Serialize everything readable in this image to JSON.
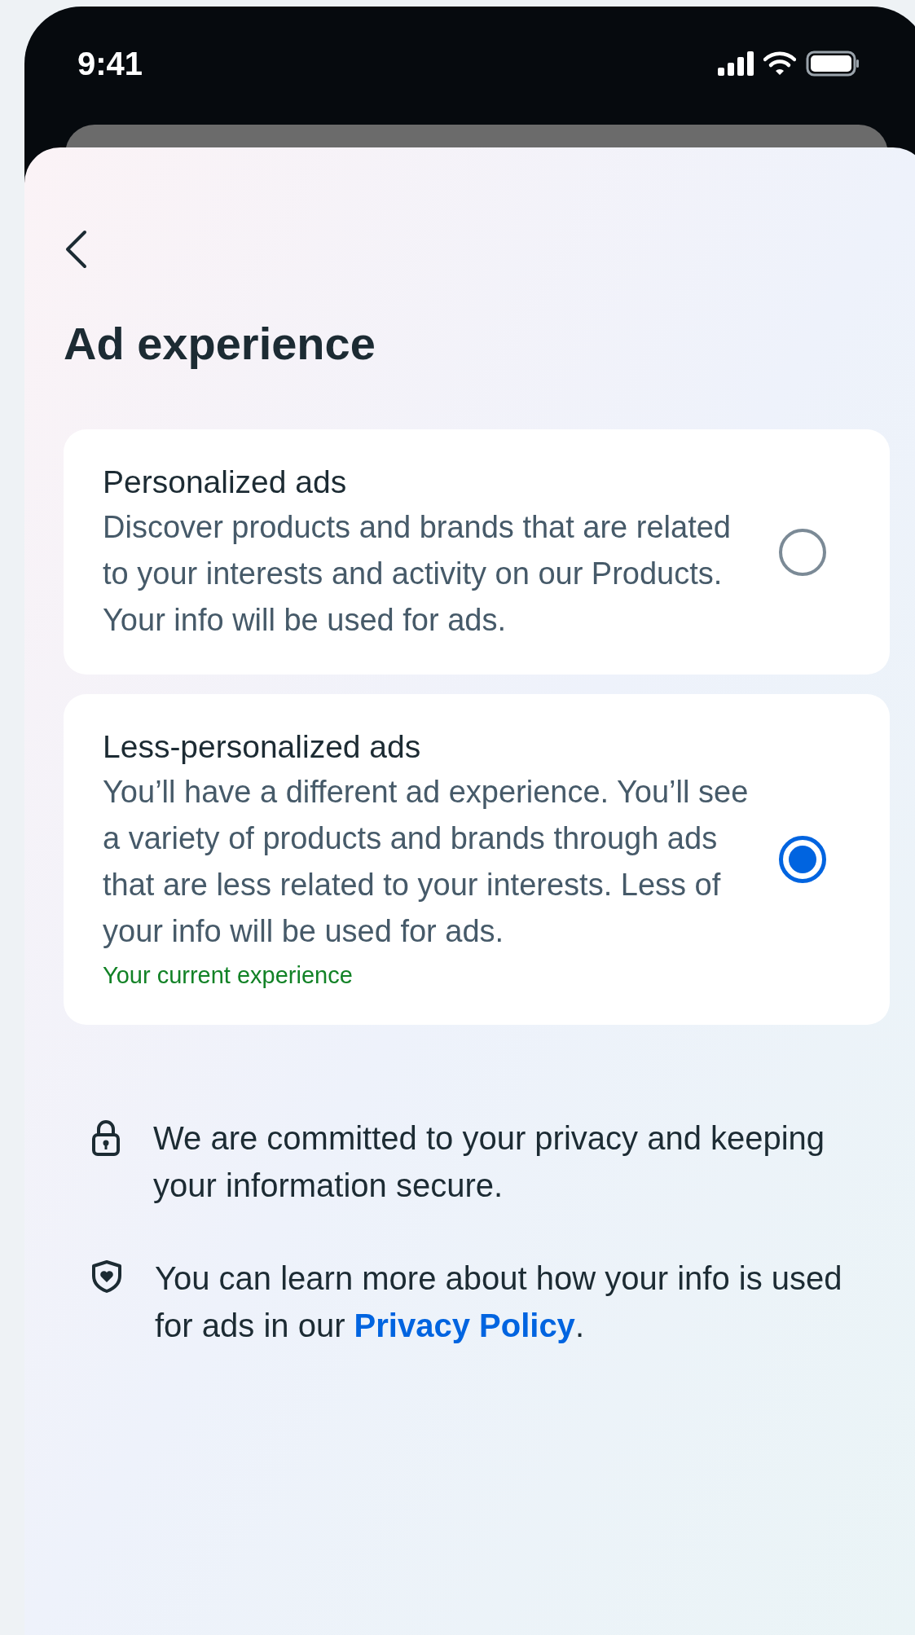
{
  "status_bar": {
    "time": "9:41"
  },
  "title": "Ad experience",
  "options": [
    {
      "title": "Personalized ads",
      "description": "Discover products and brands that are related to your interests and activity on our Products. Your info will be used for ads.",
      "selected": false
    },
    {
      "title": "Less-personalized ads",
      "description": "You’ll have a different ad experience. You’ll see a variety of products and brands through ads that are less related to your interests. Less of your info will be used for ads.",
      "note": "Your current experience",
      "selected": true
    }
  ],
  "info": [
    {
      "kind": "lock",
      "text": "We are committed to your privacy and keeping your information secure."
    },
    {
      "kind": "shield",
      "text": "You can learn more about how your info is used for ads in our ",
      "link": "Privacy Policy",
      "text_after": "."
    }
  ]
}
